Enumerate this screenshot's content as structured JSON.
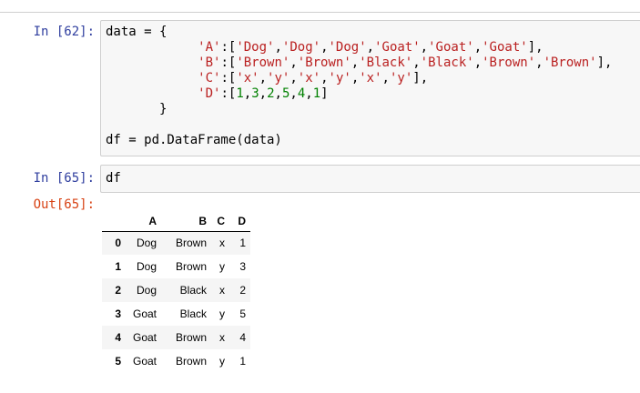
{
  "cells": [
    {
      "prompt": "In [62]:",
      "code_lines": [
        [
          "data = {"
        ],
        [
          "            ",
          "'A'",
          ":[",
          "'Dog'",
          ",",
          "'Dog'",
          ",",
          "'Dog'",
          ",",
          "'Goat'",
          ",",
          "'Goat'",
          ",",
          "'Goat'",
          "],"
        ],
        [
          "            ",
          "'B'",
          ":[",
          "'Brown'",
          ",",
          "'Brown'",
          ",",
          "'Black'",
          ",",
          "'Black'",
          ",",
          "'Brown'",
          ",",
          "'Brown'",
          "],"
        ],
        [
          "            ",
          "'C'",
          ":[",
          "'x'",
          ",",
          "'y'",
          ",",
          "'x'",
          ",",
          "'y'",
          ",",
          "'x'",
          ",",
          "'y'",
          "],"
        ],
        [
          "            ",
          "'D'",
          ":[",
          "1",
          ",",
          "3",
          ",",
          "2",
          ",",
          "5",
          ",",
          "4",
          ",",
          "1",
          "]"
        ],
        [
          "       }"
        ],
        [
          ""
        ],
        [
          "df = pd.DataFrame(data)"
        ]
      ]
    },
    {
      "prompt": "In [65]:",
      "code": "df"
    }
  ],
  "output": {
    "prompt": "Out[65]:",
    "columns": [
      "",
      "A",
      "B",
      "C",
      "D"
    ],
    "rows": [
      [
        "0",
        "Dog",
        "Brown",
        "x",
        "1"
      ],
      [
        "1",
        "Dog",
        "Brown",
        "y",
        "3"
      ],
      [
        "2",
        "Dog",
        "Black",
        "x",
        "2"
      ],
      [
        "3",
        "Goat",
        "Black",
        "y",
        "5"
      ],
      [
        "4",
        "Goat",
        "Brown",
        "x",
        "4"
      ],
      [
        "5",
        "Goat",
        "Brown",
        "y",
        "1"
      ]
    ]
  },
  "colors": {
    "in_prompt": "#303f9f",
    "out_prompt": "#d84315",
    "string": "#ba2121",
    "number": "#008000"
  }
}
